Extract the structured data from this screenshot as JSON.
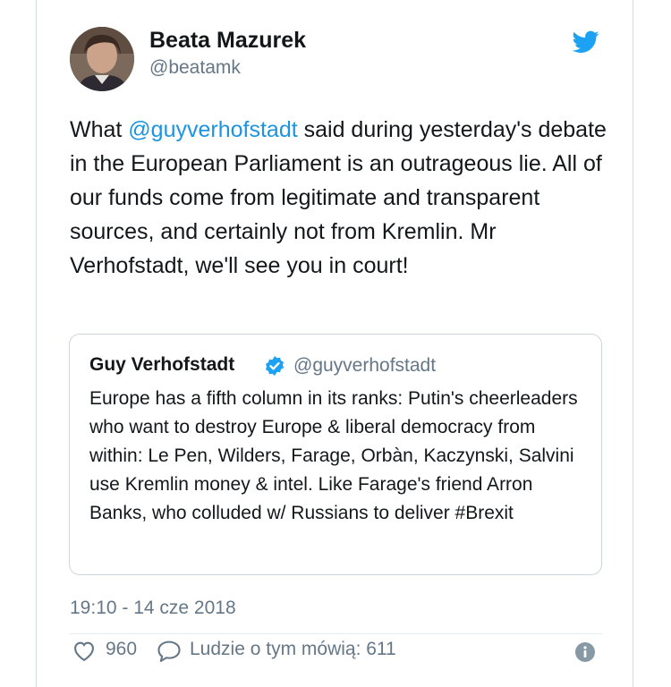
{
  "author": {
    "name": "Beata Mazurek",
    "handle": "@beatamk"
  },
  "tweet": {
    "text_before": "What ",
    "mention": "@guyverhofstadt",
    "text_after": " said during yesterday's debate in the European Parliament is an outrageous lie. All of our funds come from legitimate and transparent sources, and certainly not from Kremlin. Mr Verhofstadt, we'll see you in court!"
  },
  "quoted_tweet": {
    "name": "Guy Verhofstadt",
    "handle": "@guyverhofstadt",
    "text": "Europe has a fifth column in its ranks: Putin's cheerleaders who want to destroy Europe & liberal democracy from within: Le Pen, Wilders, Farage, Orbàn, Kaczynski, Salvini use Kremlin money & intel. Like Farage's friend Arron Banks, who colluded w/ Russians to deliver #Brexit"
  },
  "timestamp": "19:10 - 14 cze 2018",
  "actions": {
    "like_count": "960",
    "reply_label": "Ludzie o tym mówią: 611"
  },
  "icons": {
    "brand": "twitter-bird-icon",
    "verified": "verified-badge-icon",
    "like": "heart-icon",
    "reply": "speech-bubble-icon",
    "info": "info-icon"
  },
  "colors": {
    "accent": "#1da1f2",
    "link": "#1b95e0",
    "secondary_text": "#657786",
    "border": "#ccd6dd"
  }
}
